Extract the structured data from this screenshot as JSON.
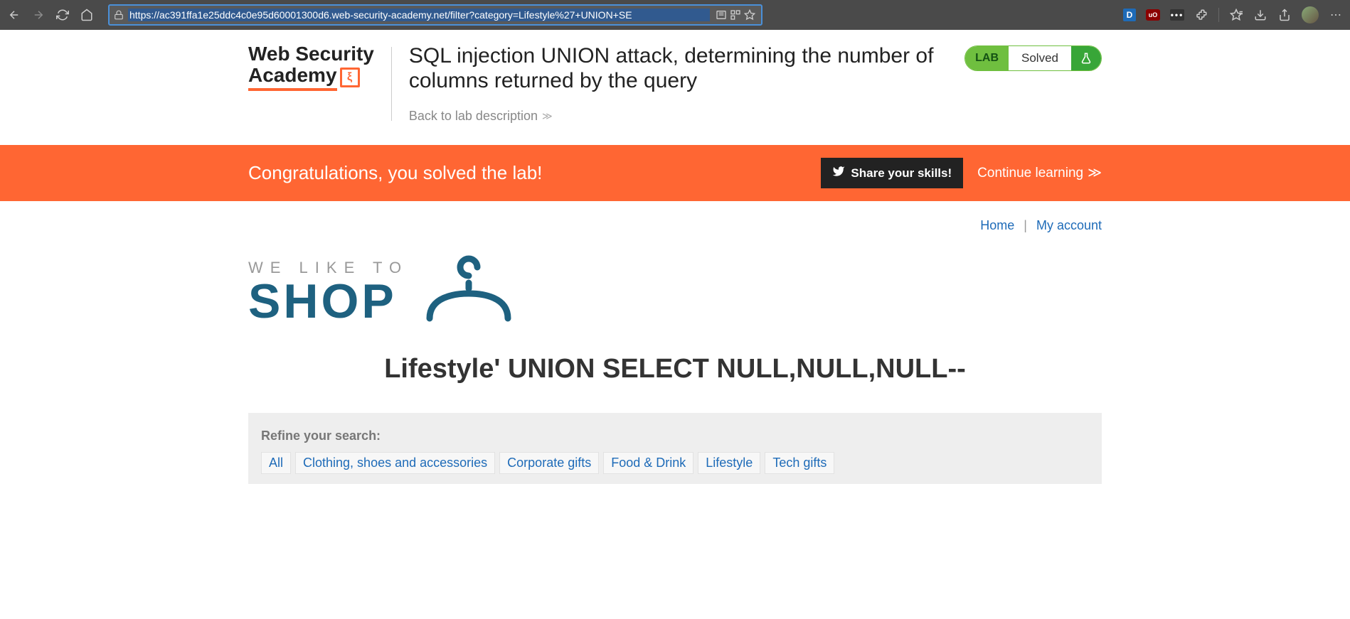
{
  "browser": {
    "url": "https://ac391ffa1e25ddc4c0e95d60001300d6.web-security-academy.net/filter?category=Lifestyle%27+UNION+SE"
  },
  "logo": {
    "line1": "Web Security",
    "line2": "Academy",
    "glyph": "ξ"
  },
  "lab": {
    "title": "SQL injection UNION attack, determining the number of columns returned by the query",
    "back": "Back to lab description",
    "pill_label": "LAB",
    "pill_status": "Solved"
  },
  "banner": {
    "congrats": "Congratulations, you solved the lab!",
    "share": "Share your skills!",
    "continue": "Continue learning"
  },
  "nav": {
    "home": "Home",
    "account": "My account"
  },
  "hero": {
    "tagline": "WE LIKE TO",
    "shop": "SHOP"
  },
  "injection_heading": "Lifestyle' UNION SELECT NULL,NULL,NULL--",
  "refine": {
    "title": "Refine your search:",
    "links": [
      "All",
      "Clothing, shoes and accessories",
      "Corporate gifts",
      "Food & Drink",
      "Lifestyle",
      "Tech gifts"
    ]
  }
}
